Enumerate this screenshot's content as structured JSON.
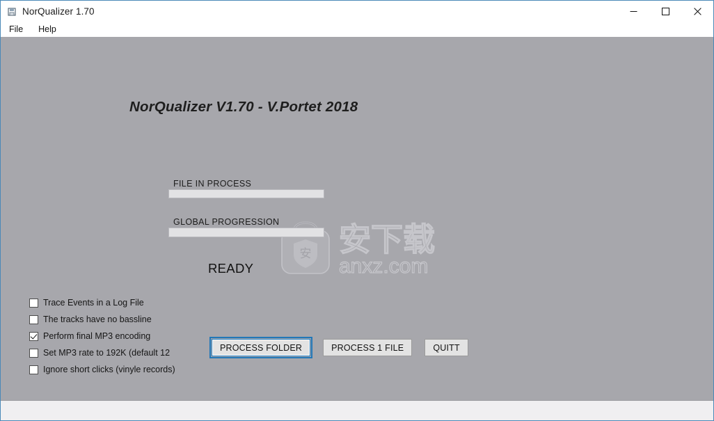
{
  "window": {
    "title": "NorQualizer 1.70",
    "icon": "app-window-icon",
    "controls": {
      "minimize": "minimize-icon",
      "maximize": "maximize-icon",
      "close": "close-icon"
    }
  },
  "menu": {
    "items": [
      {
        "label": "File"
      },
      {
        "label": "Help"
      }
    ]
  },
  "content": {
    "heading": "NorQualizer V1.70 - V.Portet 2018",
    "progress": {
      "file_in_process": {
        "label": "FILE IN PROCESS",
        "value": 0
      },
      "global_progression": {
        "label": "GLOBAL PROGRESSION",
        "value": 0
      }
    },
    "status_text": "READY",
    "options": [
      {
        "label": "Trace Events in a Log File",
        "checked": false
      },
      {
        "label": "The tracks have no bassline",
        "checked": false
      },
      {
        "label": "Perform final MP3 encoding",
        "checked": true
      },
      {
        "label": "Set MP3 rate to 192K (default 12",
        "checked": false
      },
      {
        "label": "Ignore short clicks (vinyle records)",
        "checked": false
      }
    ],
    "buttons": [
      {
        "label": "PROCESS FOLDER",
        "focused": true
      },
      {
        "label": "PROCESS 1 FILE",
        "focused": false
      },
      {
        "label": "QUITT",
        "focused": false
      }
    ]
  },
  "watermark": {
    "cn_text": "安下载",
    "domain_text": "anxz.com",
    "shield_char": "安"
  },
  "colors": {
    "client_bg": "#a7a7ac",
    "window_border": "#4a89b8",
    "focus_blue": "#2077b8",
    "progress_fill": "#e2e2e4",
    "button_face": "#e3e3e3",
    "status_bar": "#f0eff1"
  }
}
